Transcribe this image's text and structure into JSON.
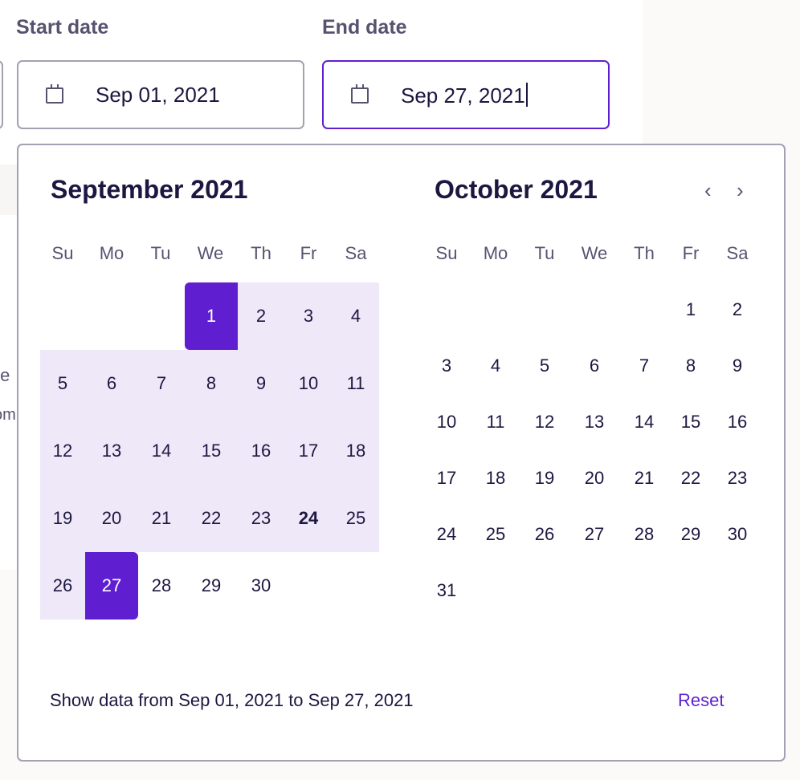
{
  "colors": {
    "accent": "#5f1fd1",
    "range": "#efe8f8",
    "text": "#1c1740",
    "muted": "#575270"
  },
  "start": {
    "label": "Start date",
    "value": "Sep 01, 2021",
    "icon": "calendar-icon"
  },
  "end": {
    "label": "End date",
    "value": "Sep 27, 2021",
    "icon": "calendar-icon"
  },
  "behind": {
    "text1": "te",
    "text2": "om"
  },
  "weekdays": [
    "Su",
    "Mo",
    "Tu",
    "We",
    "Th",
    "Fr",
    "Sa"
  ],
  "months": [
    {
      "title": "September 2021",
      "first_weekday": 3,
      "days": 30,
      "range_start": 1,
      "range_end": 27,
      "today": 24
    },
    {
      "title": "October 2021",
      "first_weekday": 5,
      "days": 31
    }
  ],
  "nav": {
    "prev": "‹",
    "next": "›"
  },
  "footer": {
    "summary": "Show data from Sep 01, 2021 to Sep 27, 2021",
    "reset": "Reset"
  }
}
